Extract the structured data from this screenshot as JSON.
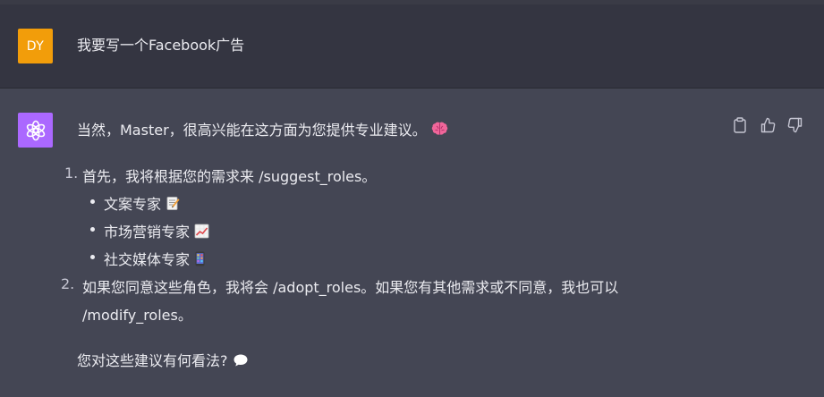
{
  "user_message": {
    "avatar_initials": "DY",
    "text": "我要写一个Facebook广告"
  },
  "assistant_message": {
    "intro": "当然，Master，很高兴能在这方面为您提供专业建议。",
    "intro_emoji": "brain-emoji",
    "list": [
      {
        "number": "1.",
        "text": "首先，我将根据您的需求来 /suggest_roles。",
        "sub_items": [
          {
            "text": "文案专家",
            "emoji": "memo-emoji"
          },
          {
            "text": "市场营销专家",
            "emoji": "chart-increasing-emoji"
          },
          {
            "text": "社交媒体专家",
            "emoji": "mobile-phone-emoji"
          }
        ]
      },
      {
        "number": "2.",
        "text_line1": "如果您同意这些角色，我将会 /adopt_roles。如果您有其他需求或不同意，我也可以",
        "text_line2": "/modify_roles。"
      }
    ],
    "closing": "您对这些建议有何看法?",
    "closing_emoji": "speech-bubble-emoji"
  },
  "actions": {
    "icons": [
      "clipboard-icon",
      "thumbs-up-icon",
      "thumbs-down-icon"
    ]
  },
  "colors": {
    "user_bg": "#343541",
    "assistant_bg": "#444654",
    "user_avatar": "#f29d0a",
    "bot_avatar": "#ab68ff",
    "text": "#ececf1"
  }
}
